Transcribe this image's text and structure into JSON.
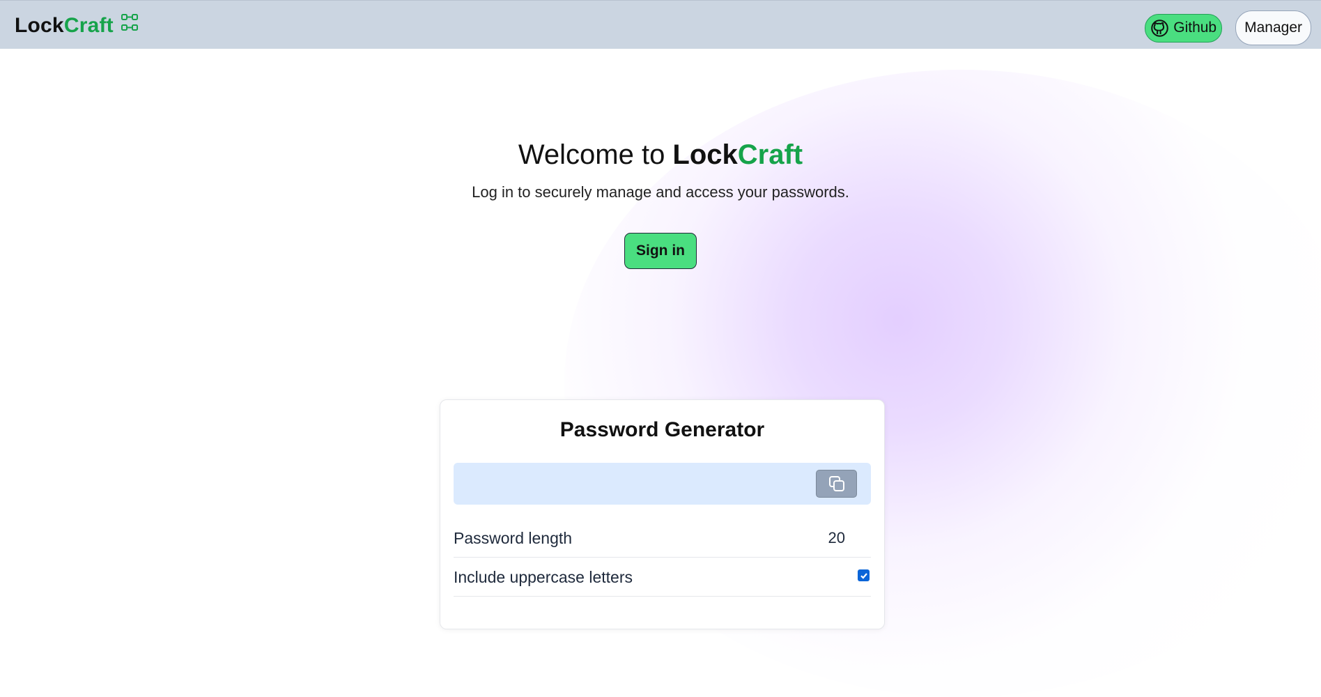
{
  "header": {
    "brand": {
      "prefix": "Lock",
      "suffix": "Craft",
      "icon": "network-icon"
    },
    "github_button": {
      "label": "Github",
      "icon": "github-icon"
    },
    "manager_button": {
      "label": "Manager"
    }
  },
  "hero": {
    "title_prefix": "Welcome to ",
    "brand_prefix": "Lock",
    "brand_suffix": "Craft",
    "subtitle": "Log in to securely manage and access your passwords.",
    "signin_label": "Sign in"
  },
  "generator": {
    "title": "Password Generator",
    "copy_icon": "copy-icon",
    "length_label": "Password length",
    "length_value": "20",
    "uppercase_label": "Include uppercase letters",
    "uppercase_checked": true
  },
  "colors": {
    "header_bg": "#cbd5e1",
    "brand_green": "#16a34a",
    "button_green": "#4ade80",
    "password_box_bg": "#dbeafe",
    "copy_button_bg": "#94a3b8",
    "checkbox_blue": "#0b65d8"
  }
}
